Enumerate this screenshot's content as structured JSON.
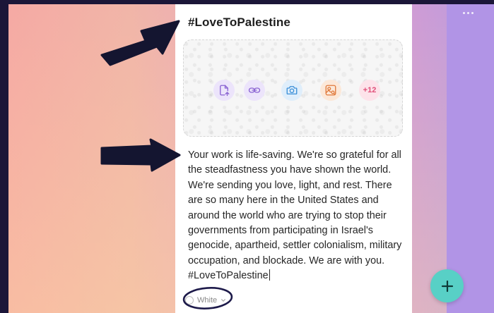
{
  "board": {
    "background_colors": [
      "#f5a9a4",
      "#e9a8c0",
      "#b89ce0"
    ],
    "menu_icon": "more-horizontal-icon"
  },
  "post": {
    "title": "#LoveToPalestine",
    "attachments": {
      "buttons": [
        {
          "name": "file-upload",
          "icon": "file-upload-icon"
        },
        {
          "name": "link",
          "icon": "link-icon"
        },
        {
          "name": "camera",
          "icon": "camera-icon"
        },
        {
          "name": "image-search",
          "icon": "image-search-icon"
        },
        {
          "name": "more",
          "label": "+12"
        }
      ]
    },
    "body": "Your work is life-saving. We're so grateful for all the steadfastness you have shown the world. We're sending you love, light, and rest. There are so many here in the United States and around the world who are trying to stop their governments from participating in Israel's genocide, apartheid, settler colonialism, military occupation, and blockade. We are with you. #LoveToPalestine",
    "color": {
      "label": "White",
      "icon": "chevron-down-icon"
    }
  },
  "fab": {
    "icon": "plus-icon",
    "color": "#58d0c6"
  },
  "annotations": {
    "arrow_color": "#141530",
    "ellipse_color": "#1d1a4a"
  }
}
